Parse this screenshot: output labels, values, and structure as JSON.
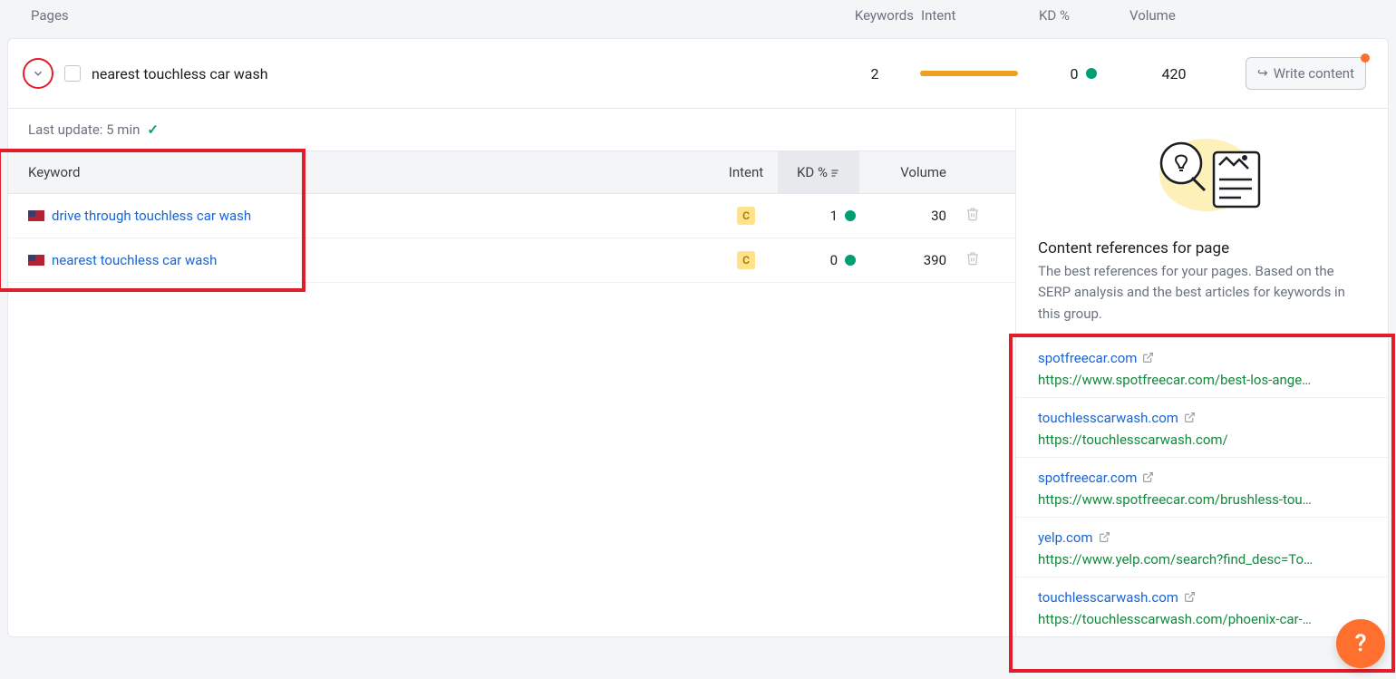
{
  "header": {
    "pages": "Pages",
    "keywords": "Keywords",
    "intent": "Intent",
    "kd": "KD %",
    "volume": "Volume"
  },
  "page_row": {
    "title": "nearest touchless car wash",
    "keywords_count": "2",
    "kd_value": "0",
    "volume": "420",
    "write_content": "Write content"
  },
  "kw_panel": {
    "last_update": "Last update: 5 min",
    "col_keyword": "Keyword",
    "col_intent": "Intent",
    "col_kd": "KD %",
    "col_volume": "Volume"
  },
  "keywords": [
    {
      "label": "drive through touchless car wash",
      "intent": "C",
      "kd": "1",
      "volume": "30"
    },
    {
      "label": "nearest touchless car wash",
      "intent": "C",
      "kd": "0",
      "volume": "390"
    }
  ],
  "refs": {
    "title": "Content references for page",
    "desc": "The best references for your pages. Based on the SERP analysis and the best articles for keywords in this group.",
    "items": [
      {
        "domain": "spotfreecar.com",
        "url": "https://www.spotfreecar.com/best-los-ange…"
      },
      {
        "domain": "touchlesscarwash.com",
        "url": "https://touchlesscarwash.com/"
      },
      {
        "domain": "spotfreecar.com",
        "url": "https://www.spotfreecar.com/brushless-tou…"
      },
      {
        "domain": "yelp.com",
        "url": "https://www.yelp.com/search?find_desc=To…"
      },
      {
        "domain": "touchlesscarwash.com",
        "url": "https://touchlesscarwash.com/phoenix-car-…"
      }
    ]
  },
  "help": "?"
}
